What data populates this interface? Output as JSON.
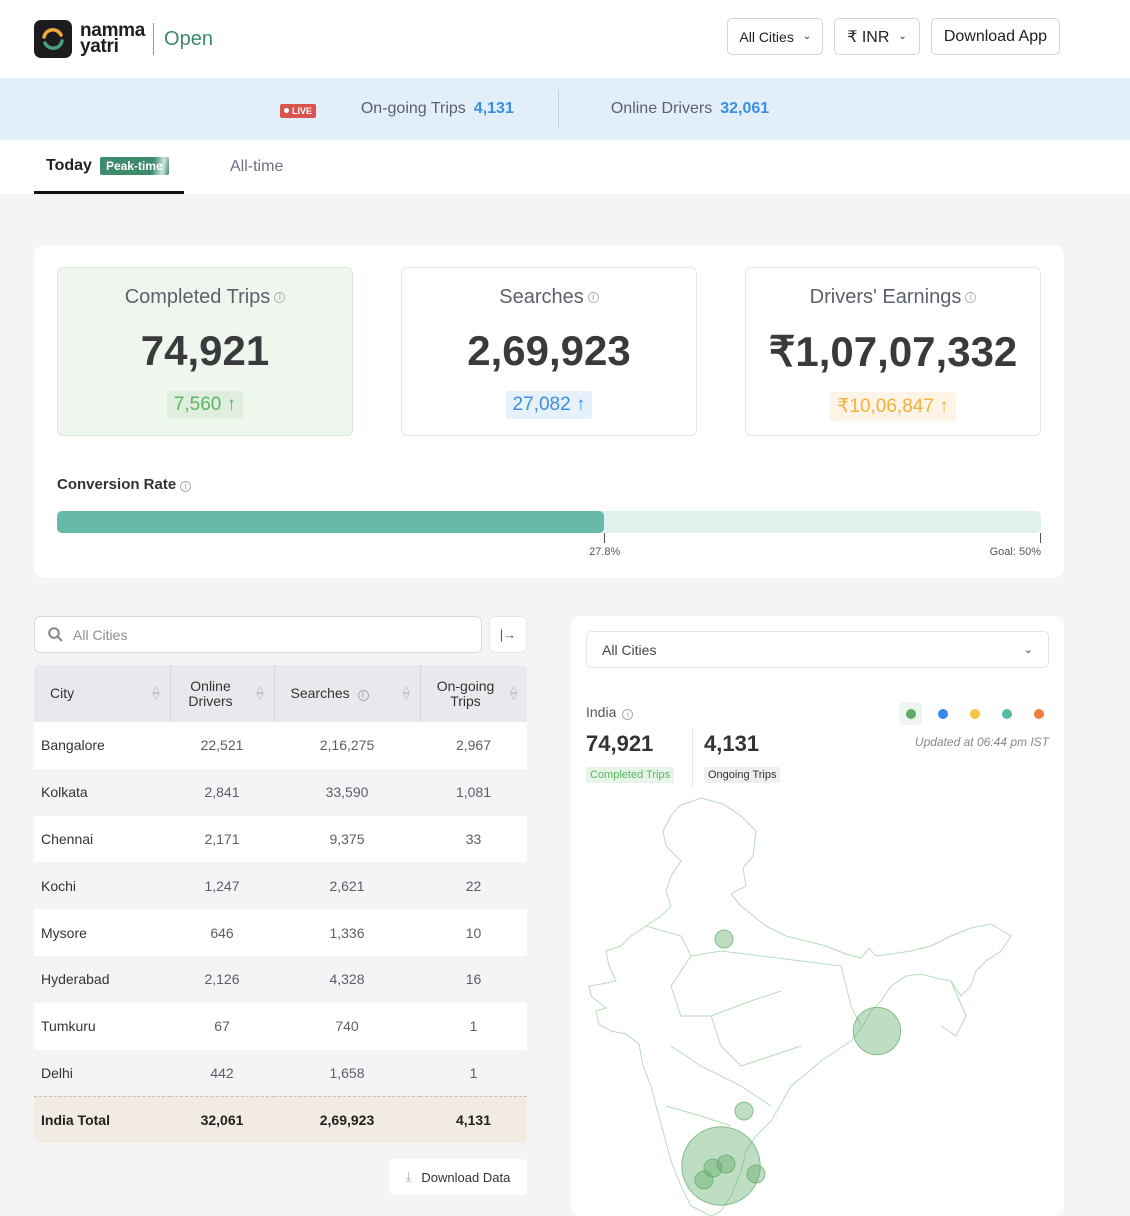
{
  "header": {
    "brand_line1": "namma",
    "brand_line2": "yatri",
    "brand_suffix": "Open",
    "city_select": "All Cities",
    "currency_select": "₹ INR",
    "download_app": "Download App"
  },
  "live_bar": {
    "badge": "LIVE",
    "ongoing_label": "On-going Trips",
    "ongoing_value": "4,131",
    "drivers_label": "Online Drivers",
    "drivers_value": "32,061"
  },
  "tabs": {
    "today": "Today",
    "peak_badge": "Peak-time",
    "all_time": "All-time"
  },
  "cards": [
    {
      "title": "Completed Trips",
      "value": "74,921",
      "delta": "7,560",
      "color": "#5cb562"
    },
    {
      "title": "Searches",
      "value": "2,69,923",
      "delta": "27,082",
      "color": "#3b8ee0"
    },
    {
      "title": "Drivers' Earnings",
      "value": "₹1,07,07,332",
      "delta": "₹10,06,847",
      "color": "#f2b03e"
    }
  ],
  "conversion": {
    "title": "Conversion Rate",
    "value_percent": 27.8,
    "value_label": "27.8%",
    "goal_percent": 50,
    "goal_label": "Goal: 50%"
  },
  "table": {
    "search_placeholder": "All Cities",
    "columns": [
      "City",
      "Online Drivers",
      "Searches",
      "On-going Trips"
    ],
    "rows": [
      [
        "Bangalore",
        "22,521",
        "2,16,275",
        "2,967"
      ],
      [
        "Kolkata",
        "2,841",
        "33,590",
        "1,081"
      ],
      [
        "Chennai",
        "2,171",
        "9,375",
        "33"
      ],
      [
        "Kochi",
        "1,247",
        "2,621",
        "22"
      ],
      [
        "Mysore",
        "646",
        "1,336",
        "10"
      ],
      [
        "Hyderabad",
        "2,126",
        "4,328",
        "16"
      ],
      [
        "Tumkuru",
        "67",
        "740",
        "1"
      ],
      [
        "Delhi",
        "442",
        "1,658",
        "1"
      ]
    ],
    "total": [
      "India Total",
      "32,061",
      "2,69,923",
      "4,131"
    ],
    "download_label": "Download Data"
  },
  "map": {
    "select": "All Cities",
    "region": "India",
    "completed_value": "74,921",
    "completed_label": "Completed Trips",
    "ongoing_value": "4,131",
    "ongoing_label": "Ongoing Trips",
    "updated": "Updated at 06:44 pm IST",
    "legend_colors": [
      "#5cab66",
      "#3b82f6",
      "#f5c242",
      "#5ab8a3",
      "#ee7f3b"
    ]
  }
}
